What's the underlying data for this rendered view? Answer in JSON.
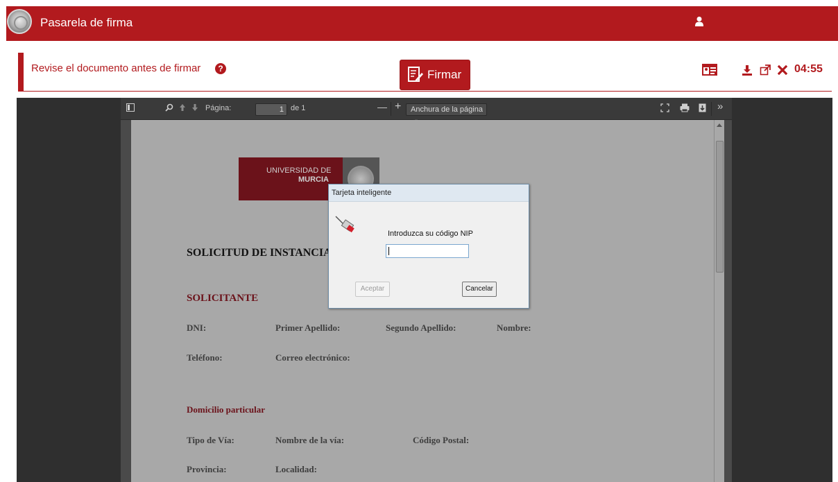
{
  "app": {
    "title": "Pasarela de firma"
  },
  "header": {
    "review_text": "Revise el documento antes de firmar",
    "help_icon": "?",
    "sign_label": "Firmar",
    "timer": "04:55"
  },
  "viewer": {
    "page_label": "Página:",
    "page_value": "1",
    "page_total": "de 1",
    "zoom_value": "Anchura de la página",
    "minus": "—",
    "plus": "+",
    "more": "»"
  },
  "document": {
    "university_line1": "UNIVERSIDAD DE",
    "university_line2": "MURCIA",
    "title": "SOLICITUD DE INSTANCIA",
    "sections": {
      "solicitante": "SOLICITANTE",
      "domicilio": "Domicilio particular"
    },
    "fields": {
      "dni": "DNI:",
      "primer_apellido": "Primer Apellido:",
      "segundo_apellido": "Segundo Apellido:",
      "nombre": "Nombre:",
      "telefono": "Teléfono:",
      "correo": "Correo electrónico:",
      "tipo_via": "Tipo de Vía:",
      "nombre_via": "Nombre de la vía:",
      "codigo_postal": "Código Postal:",
      "provincia": "Provincia:",
      "localidad": "Localidad:"
    }
  },
  "dialog": {
    "title": "Tarjeta inteligente",
    "prompt": "Introduzca su código NIP",
    "pin_value": "",
    "accept": "Aceptar",
    "cancel": "Cancelar"
  },
  "colors": {
    "brand": "#b21a1e",
    "viewer_bg": "#2f2f2f"
  }
}
